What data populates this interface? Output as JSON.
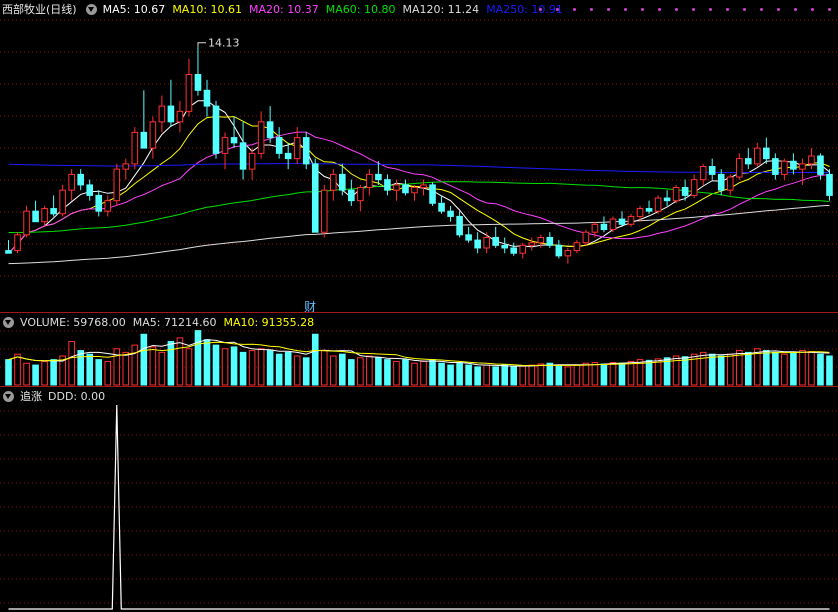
{
  "price_panel": {
    "title": "西部牧业(日线)",
    "ma_labels": [
      {
        "label": "MA5: 10.67",
        "color": "#ffffff"
      },
      {
        "label": "MA10: 10.61",
        "color": "#ffff00"
      },
      {
        "label": "MA20: 10.37",
        "color": "#ff40ff"
      },
      {
        "label": "MA60: 10.80",
        "color": "#00e000"
      },
      {
        "label": "MA120: 11.24",
        "color": "#dddddd"
      },
      {
        "label": "MA250: 10.91",
        "color": "#1c1cff"
      }
    ],
    "high_marker": "14.13",
    "finance_marker": "财"
  },
  "volume_panel": {
    "labels": [
      {
        "label": "VOLUME: 59768.00",
        "color": "#dddddd"
      },
      {
        "label": "MA5: 71214.60",
        "color": "#dddddd"
      },
      {
        "label": "MA10: 91355.28",
        "color": "#ffff00"
      }
    ]
  },
  "indicator_panel": {
    "name": "追涨",
    "labels": [
      {
        "label": "DDD: 0.00",
        "color": "#dddddd"
      }
    ]
  },
  "colors": {
    "up": "#ff3030",
    "down": "#54ffff",
    "grid": "#8b1010",
    "bg": "#000000"
  },
  "chart_data": [
    {
      "type": "candlestick",
      "title": "西部牧业(日线)",
      "annotations": [
        "14.13",
        "财"
      ],
      "ohlc": [
        [
          10.25,
          10.45,
          10.2,
          10.2
        ],
        [
          10.25,
          10.6,
          10.2,
          10.55
        ],
        [
          10.55,
          11.1,
          10.5,
          11.0
        ],
        [
          11.0,
          11.2,
          10.8,
          10.8
        ],
        [
          10.8,
          11.1,
          10.7,
          11.05
        ],
        [
          11.05,
          11.3,
          10.9,
          10.95
        ],
        [
          10.95,
          11.5,
          10.9,
          11.4
        ],
        [
          11.4,
          11.8,
          11.2,
          11.7
        ],
        [
          11.7,
          11.8,
          11.4,
          11.5
        ],
        [
          11.5,
          11.6,
          11.2,
          11.3
        ],
        [
          11.3,
          11.4,
          10.9,
          11.0
        ],
        [
          11.0,
          11.3,
          10.9,
          11.2
        ],
        [
          11.2,
          11.9,
          11.1,
          11.8
        ],
        [
          11.8,
          12.0,
          11.6,
          11.9
        ],
        [
          11.9,
          12.6,
          11.8,
          12.5
        ],
        [
          12.5,
          13.3,
          12.3,
          12.2
        ],
        [
          12.2,
          12.8,
          12.0,
          12.7
        ],
        [
          12.7,
          13.2,
          12.5,
          13.0
        ],
        [
          13.0,
          13.5,
          12.6,
          12.7
        ],
        [
          12.7,
          13.1,
          12.5,
          12.9
        ],
        [
          12.9,
          13.9,
          12.8,
          13.6
        ],
        [
          13.6,
          14.13,
          13.2,
          13.3
        ],
        [
          13.3,
          13.5,
          12.8,
          13.0
        ],
        [
          13.0,
          13.1,
          12.0,
          12.1
        ],
        [
          12.1,
          12.5,
          11.8,
          12.4
        ],
        [
          12.4,
          12.8,
          12.2,
          12.3
        ],
        [
          12.3,
          12.7,
          11.6,
          11.8
        ],
        [
          11.8,
          12.2,
          11.6,
          12.1
        ],
        [
          12.1,
          12.9,
          12.0,
          12.7
        ],
        [
          12.7,
          13.0,
          12.3,
          12.4
        ],
        [
          12.4,
          12.6,
          12.0,
          12.1
        ],
        [
          12.1,
          12.3,
          11.8,
          12.0
        ],
        [
          12.0,
          12.6,
          11.9,
          12.4
        ],
        [
          12.4,
          12.5,
          11.8,
          11.9
        ],
        [
          11.9,
          12.0,
          10.6,
          10.6
        ],
        [
          10.6,
          11.5,
          10.5,
          11.4
        ],
        [
          11.4,
          11.8,
          11.2,
          11.7
        ],
        [
          11.7,
          11.9,
          11.3,
          11.4
        ],
        [
          11.4,
          11.6,
          11.1,
          11.2
        ],
        [
          11.2,
          11.5,
          11.0,
          11.45
        ],
        [
          11.45,
          11.8,
          11.3,
          11.7
        ],
        [
          11.7,
          11.95,
          11.5,
          11.6
        ],
        [
          11.6,
          11.7,
          11.3,
          11.4
        ],
        [
          11.4,
          11.6,
          11.2,
          11.5
        ],
        [
          11.5,
          11.6,
          11.3,
          11.35
        ],
        [
          11.35,
          11.5,
          11.2,
          11.45
        ],
        [
          11.45,
          11.6,
          11.3,
          11.5
        ],
        [
          11.5,
          11.55,
          11.1,
          11.15
        ],
        [
          11.15,
          11.3,
          10.95,
          11.0
        ],
        [
          11.0,
          11.1,
          10.8,
          10.9
        ],
        [
          10.9,
          11.0,
          10.5,
          10.55
        ],
        [
          10.55,
          10.7,
          10.4,
          10.45
        ],
        [
          10.45,
          10.6,
          10.2,
          10.3
        ],
        [
          10.3,
          10.6,
          10.2,
          10.5
        ],
        [
          10.5,
          10.7,
          10.3,
          10.35
        ],
        [
          10.35,
          10.5,
          10.2,
          10.3
        ],
        [
          10.3,
          10.4,
          10.15,
          10.2
        ],
        [
          10.2,
          10.4,
          10.1,
          10.35
        ],
        [
          10.35,
          10.5,
          10.25,
          10.4
        ],
        [
          10.4,
          10.55,
          10.3,
          10.5
        ],
        [
          10.5,
          10.6,
          10.3,
          10.35
        ],
        [
          10.35,
          10.45,
          10.1,
          10.15
        ],
        [
          10.15,
          10.3,
          10.0,
          10.25
        ],
        [
          10.25,
          10.45,
          10.2,
          10.4
        ],
        [
          10.4,
          10.65,
          10.35,
          10.6
        ],
        [
          10.6,
          10.8,
          10.5,
          10.75
        ],
        [
          10.75,
          10.9,
          10.6,
          10.65
        ],
        [
          10.65,
          10.9,
          10.6,
          10.85
        ],
        [
          10.85,
          11.0,
          10.7,
          10.75
        ],
        [
          10.75,
          10.95,
          10.7,
          10.9
        ],
        [
          10.9,
          11.1,
          10.8,
          11.05
        ],
        [
          11.05,
          11.2,
          10.95,
          11.0
        ],
        [
          11.0,
          11.3,
          10.95,
          11.25
        ],
        [
          11.25,
          11.4,
          11.1,
          11.2
        ],
        [
          11.2,
          11.5,
          11.15,
          11.45
        ],
        [
          11.45,
          11.6,
          11.2,
          11.3
        ],
        [
          11.3,
          11.7,
          11.25,
          11.6
        ],
        [
          11.6,
          11.9,
          11.5,
          11.85
        ],
        [
          11.85,
          12.0,
          11.6,
          11.7
        ],
        [
          11.7,
          11.8,
          11.3,
          11.4
        ],
        [
          11.4,
          11.7,
          11.3,
          11.65
        ],
        [
          11.65,
          12.1,
          11.6,
          12.0
        ],
        [
          12.0,
          12.2,
          11.8,
          11.9
        ],
        [
          11.9,
          12.3,
          11.85,
          12.2
        ],
        [
          12.2,
          12.4,
          11.9,
          12.0
        ],
        [
          12.0,
          12.1,
          11.6,
          11.7
        ],
        [
          11.7,
          12.0,
          11.6,
          11.95
        ],
        [
          11.95,
          12.1,
          11.7,
          11.8
        ],
        [
          11.8,
          12.0,
          11.5,
          11.9
        ],
        [
          11.9,
          12.2,
          11.8,
          12.05
        ],
        [
          12.05,
          12.1,
          11.6,
          11.7
        ],
        [
          11.7,
          11.8,
          11.2,
          11.3
        ]
      ]
    },
    {
      "type": "bar",
      "title": "VOLUME",
      "values": [
        70,
        85,
        60,
        55,
        65,
        70,
        80,
        120,
        95,
        85,
        70,
        65,
        100,
        90,
        110,
        140,
        105,
        90,
        120,
        130,
        100,
        150,
        125,
        110,
        100,
        105,
        90,
        95,
        100,
        95,
        85,
        90,
        80,
        75,
        140,
        95,
        80,
        85,
        70,
        75,
        80,
        75,
        70,
        65,
        70,
        60,
        65,
        70,
        60,
        55,
        60,
        55,
        50,
        55,
        50,
        55,
        50,
        52,
        55,
        58,
        60,
        55,
        50,
        55,
        60,
        62,
        58,
        62,
        60,
        65,
        70,
        68,
        72,
        75,
        80,
        78,
        85,
        90,
        85,
        80,
        85,
        95,
        90,
        100,
        95,
        90,
        85,
        88,
        95,
        92,
        85,
        80
      ]
    },
    {
      "type": "line",
      "title": "追涨",
      "series": [
        {
          "name": "DDD",
          "values": [
            0,
            0,
            0,
            0,
            0,
            0,
            0,
            0,
            0,
            0,
            0,
            0,
            1,
            0,
            0,
            0,
            0,
            0,
            0,
            0,
            0,
            0,
            0,
            0,
            0,
            0,
            0,
            0,
            0,
            0,
            0,
            0,
            0,
            0,
            0,
            0,
            0,
            0,
            0,
            0,
            0,
            0,
            0,
            0,
            0,
            0,
            0,
            0,
            0,
            0,
            0,
            0,
            0,
            0,
            0,
            0,
            0,
            0,
            0,
            0,
            0,
            0,
            0,
            0,
            0,
            0,
            0,
            0,
            0,
            0,
            0,
            0,
            0,
            0,
            0,
            0,
            0,
            0,
            0,
            0,
            0,
            0,
            0,
            0,
            0,
            0,
            0,
            0,
            0,
            0,
            0,
            0
          ]
        }
      ]
    }
  ]
}
